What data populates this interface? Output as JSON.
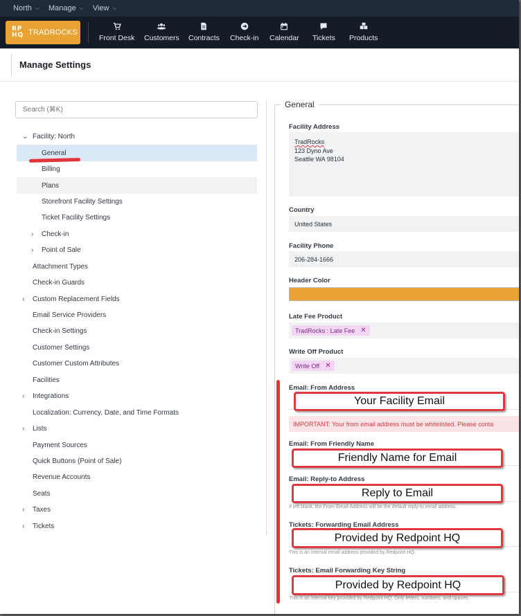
{
  "topmenu": [
    {
      "label": "North"
    },
    {
      "label": "Manage"
    },
    {
      "label": "View"
    }
  ],
  "brand": {
    "mark": "RPHQ",
    "name": "TRADROCKS",
    "color": "#e8a334"
  },
  "nav": [
    {
      "label": "Front Desk",
      "icon": "cart-icon"
    },
    {
      "label": "Customers",
      "icon": "users-icon"
    },
    {
      "label": "Contracts",
      "icon": "contract-icon"
    },
    {
      "label": "Check-in",
      "icon": "arrow-circle-icon"
    },
    {
      "label": "Calendar",
      "icon": "calendar-icon"
    },
    {
      "label": "Tickets",
      "icon": "chat-icon"
    },
    {
      "label": "Products",
      "icon": "boxes-icon"
    }
  ],
  "page": {
    "title": "Manage Settings"
  },
  "search": {
    "placeholder": "Search (⌘K)"
  },
  "tree": [
    {
      "label": "Facility: North",
      "twisty": "⌄"
    },
    {
      "label": "General"
    },
    {
      "label": "Billing"
    },
    {
      "label": "Plans"
    },
    {
      "label": "Storefront Facility Settings"
    },
    {
      "label": "Ticket Facility Settings"
    },
    {
      "label": "Check-in",
      "twisty": "›"
    },
    {
      "label": "Point of Sale",
      "twisty": "›"
    },
    {
      "label": "Attachment Types"
    },
    {
      "label": "Check-in Guards"
    },
    {
      "label": "Custom Replacement Fields",
      "twisty": "›"
    },
    {
      "label": "Email Service Providers"
    },
    {
      "label": "Check-in Settings"
    },
    {
      "label": "Customer Settings"
    },
    {
      "label": "Customer Custom Attributes"
    },
    {
      "label": "Facilities"
    },
    {
      "label": "Integrations",
      "twisty": "›"
    },
    {
      "label": "Localization: Currency, Date, and Time Formats"
    },
    {
      "label": "Lists",
      "twisty": "›"
    },
    {
      "label": "Payment Sources"
    },
    {
      "label": "Quick Buttons (Point of Sale)"
    },
    {
      "label": "Revenue Accounts"
    },
    {
      "label": "Seats"
    },
    {
      "label": "Taxes",
      "twisty": "›"
    },
    {
      "label": "Tickets",
      "twisty": "›"
    }
  ],
  "general": {
    "legend": "General",
    "address_label": "Facility Address",
    "address_lines": [
      "TradRocks",
      "123 Dyno Ave",
      "Seattle WA 98104"
    ],
    "country_label": "Country",
    "country_value": "United States",
    "phone_label": "Facility Phone",
    "phone_value": "206-284-1666",
    "header_color_label": "Header Color",
    "header_color_value": "#e8a334",
    "late_fee_label": "Late Fee Product",
    "late_fee_chip": "TradRocks : Late Fee",
    "write_off_label": "Write Off Product",
    "write_off_chip": "Write Off",
    "chip_remove": "✕",
    "email_from_label": "Email: From Address",
    "warning": "IMPORTANT: Your from email address must be whitelisted. Please conta",
    "friendly_label": "Email: From Friendly Name",
    "reply_label": "Email: Reply-to Address",
    "reply_help": "If left blank, the From-Email-Address will be the default reply-to email address.",
    "fwd_label": "Tickets: Forwarding Email Address",
    "fwd_help": "This is an internal email address provided by Redpoint HQ.",
    "key_label": "Tickets: Email Forwarding Key String",
    "key_help": "This is an internal key provided by Redpoint HQ. Only letters, numbers, and spaces."
  },
  "annotations": {
    "from_email": "Your Facility Email",
    "friendly": "Friendly Name for Email",
    "reply": "Reply to Email",
    "fwd": "Provided by Redpoint HQ",
    "key": "Provided by Redpoint HQ"
  },
  "annotation_color": "#e0383e"
}
